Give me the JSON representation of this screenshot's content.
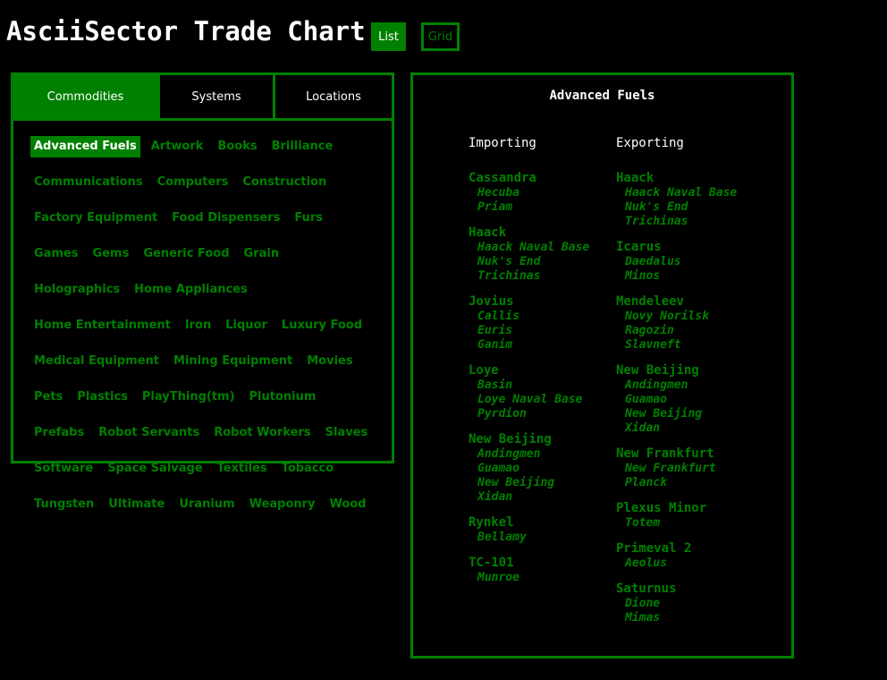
{
  "app": {
    "title": "AsciiSector Trade Chart"
  },
  "view_buttons": {
    "list": "List",
    "grid": "Grid"
  },
  "colors": {
    "background": "#000000",
    "accent": "#008000",
    "text": "#ffffff"
  },
  "tabs": [
    "Commodities",
    "Systems",
    "Locations"
  ],
  "selected_tab": "Commodities",
  "commodities": [
    "Advanced Fuels",
    "Artwork",
    "Books",
    "Brilliance",
    "Communications",
    "Computers",
    "Construction",
    "Factory Equipment",
    "Food Dispensers",
    "Furs",
    "Games",
    "Gems",
    "Generic Food",
    "Grain",
    "Holographics",
    "Home Appliances",
    "Home Entertainment",
    "Iron",
    "Liquor",
    "Luxury Food",
    "Medical Equipment",
    "Mining Equipment",
    "Movies",
    "Pets",
    "Plastics",
    "PlayThing(tm)",
    "Plutonium",
    "Prefabs",
    "Robot Servants",
    "Robot Workers",
    "Slaves",
    "Software",
    "Space Salvage",
    "Textiles",
    "Tobacco",
    "Tungsten",
    "Ultimate",
    "Uranium",
    "Weaponry",
    "Wood"
  ],
  "selected_commodity": "Advanced Fuels",
  "detail": {
    "title": "Advanced Fuels",
    "importing_label": "Importing",
    "exporting_label": "Exporting",
    "importing": [
      {
        "system": "Cassandra",
        "locations": [
          "Hecuba",
          "Priam"
        ]
      },
      {
        "system": "Haack",
        "locations": [
          "Haack Naval Base",
          "Nuk's End",
          "Trichinas"
        ]
      },
      {
        "system": "Jovius",
        "locations": [
          "Callis",
          "Euris",
          "Ganim"
        ]
      },
      {
        "system": "Loye",
        "locations": [
          "Basin",
          "Loye Naval Base",
          "Pyrdion"
        ]
      },
      {
        "system": "New Beijing",
        "locations": [
          "Andingmen",
          "Guamao",
          "New Beijing",
          "Xidan"
        ]
      },
      {
        "system": "Rynkel",
        "locations": [
          "Bellamy"
        ]
      },
      {
        "system": "TC-101",
        "locations": [
          "Munroe"
        ]
      }
    ],
    "exporting": [
      {
        "system": "Haack",
        "locations": [
          "Haack Naval Base",
          "Nuk's End",
          "Trichinas"
        ]
      },
      {
        "system": "Icarus",
        "locations": [
          "Daedalus",
          "Minos"
        ]
      },
      {
        "system": "Mendeleev",
        "locations": [
          "Novy Norilsk",
          "Ragozin",
          "Slavneft"
        ]
      },
      {
        "system": "New Beijing",
        "locations": [
          "Andingmen",
          "Guamao",
          "New Beijing",
          "Xidan"
        ]
      },
      {
        "system": "New Frankfurt",
        "locations": [
          "New Frankfurt",
          "Planck"
        ]
      },
      {
        "system": "Plexus Minor",
        "locations": [
          "Totem"
        ]
      },
      {
        "system": "Primeval 2",
        "locations": [
          "Aeolus"
        ]
      },
      {
        "system": "Saturnus",
        "locations": [
          "Dione",
          "Mimas"
        ]
      }
    ]
  }
}
